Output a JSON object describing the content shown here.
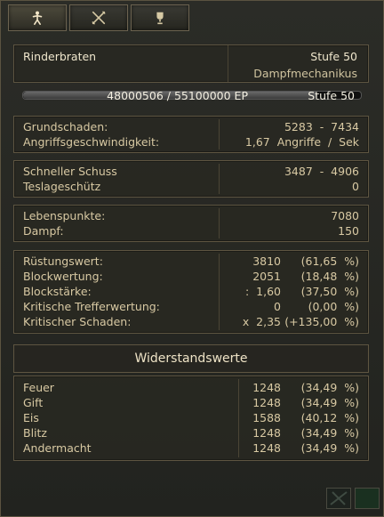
{
  "tabs": [
    {
      "id": "stats",
      "icon": "person-icon",
      "active": true
    },
    {
      "id": "skills",
      "icon": "crossed-swords-icon",
      "active": false
    },
    {
      "id": "achievements",
      "icon": "trophy-icon",
      "active": false
    }
  ],
  "character": {
    "name": "Rinderbraten",
    "level_label": "Stufe  50",
    "class": "Dampfmechanikus"
  },
  "experience": {
    "current": "48000506",
    "max": "55100000",
    "text": "48000506  /  55100000   EP",
    "level": "Stufe  50",
    "progress": 0.871
  },
  "damage": [
    {
      "label": "Grundschaden:",
      "value": "5283  -  7434"
    },
    {
      "label": "Angriffsgeschwindigkeit:",
      "value": "1,67  Angriffe  /  Sek"
    }
  ],
  "skill": [
    {
      "label": "Schneller  Schuss",
      "value": "3487  -  4906"
    },
    {
      "label": "Teslageschütz",
      "value": "0"
    }
  ],
  "vitals": [
    {
      "label": "Lebenspunkte:",
      "value": "7080"
    },
    {
      "label": "Dampf:",
      "value": "150"
    }
  ],
  "defense": [
    {
      "label": "Rüstungswert:",
      "value": "3810",
      "pct": "(61,65  %)"
    },
    {
      "label": "Blockwertung:",
      "value": "2051",
      "pct": "(18,48  %)"
    },
    {
      "label": "Blockstärke:",
      "value": ":  1,60",
      "pct": "(37,50  %)"
    },
    {
      "label": "Kritische  Trefferwertung:",
      "value": "0",
      "pct": "(0,00  %)"
    },
    {
      "label": "Kritischer  Schaden:",
      "value": "x  2,35",
      "pct": "(+135,00  %)"
    }
  ],
  "resistances_title": "Widerstandswerte",
  "resistances": [
    {
      "label": "Feuer",
      "value": "1248",
      "pct": "(34,49  %)"
    },
    {
      "label": "Gift",
      "value": "1248",
      "pct": "(34,49  %)"
    },
    {
      "label": "Eis",
      "value": "1588",
      "pct": "(40,12  %)"
    },
    {
      "label": "Blitz",
      "value": "1248",
      "pct": "(34,49  %)"
    },
    {
      "label": "Andermacht",
      "value": "1248",
      "pct": "(34,49  %)"
    }
  ]
}
